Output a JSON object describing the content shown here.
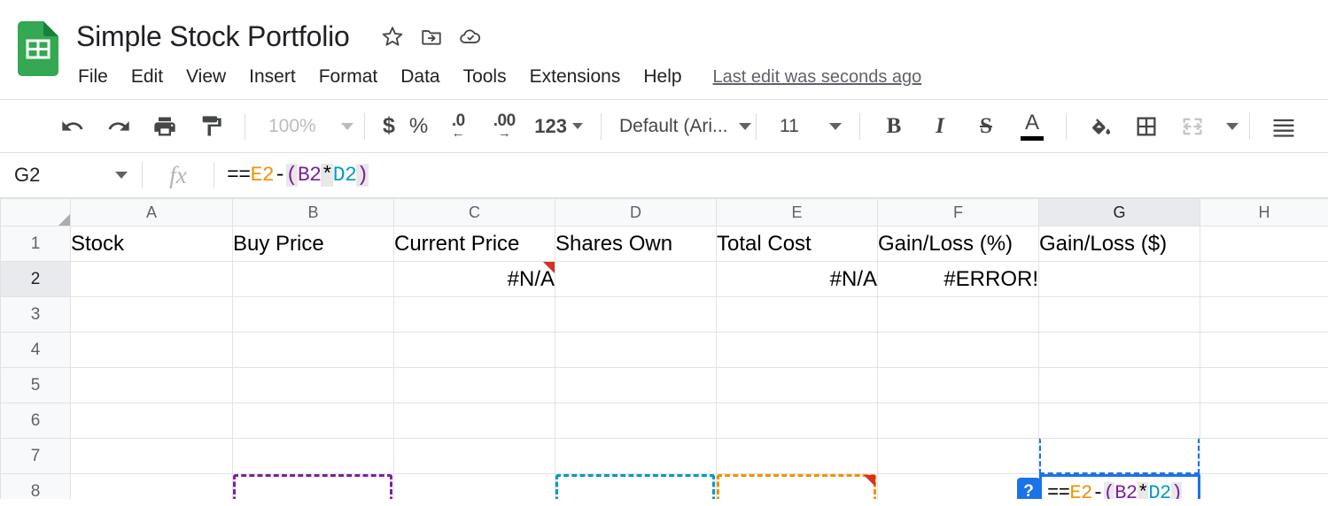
{
  "titlebar": {
    "doc_title": "Simple Stock Portfolio",
    "logo_icon": "google-sheets-logo",
    "icons": [
      {
        "name": "star-icon",
        "label": "Star"
      },
      {
        "name": "move-to-folder-icon",
        "label": "Move"
      },
      {
        "name": "cloud-saved-icon",
        "label": "Saved to Drive"
      }
    ],
    "menus": [
      "File",
      "Edit",
      "View",
      "Insert",
      "Format",
      "Data",
      "Tools",
      "Extensions",
      "Help"
    ],
    "last_edit": "Last edit was seconds ago"
  },
  "toolbar": {
    "undo": "undo-icon",
    "redo": "redo-icon",
    "print": "print-icon",
    "paint_format": "paint-format-icon",
    "zoom_value": "100%",
    "currency": "$",
    "percent": "%",
    "decrease_decimal_top": ".0",
    "decrease_decimal_arrow": "←",
    "increase_decimal_top": ".00",
    "increase_decimal_arrow": "→",
    "more_formats": "123",
    "font_family": "Default (Ari...",
    "font_size": "11",
    "bold": "B",
    "italic": "I",
    "strikethrough": "S",
    "text_color": "A",
    "text_color_swatch": "#000000",
    "fill_color": "fill-color-icon",
    "borders": "borders-icon",
    "merge_cells": "merge-cells-icon",
    "align": "align-icon"
  },
  "formula_bar": {
    "name_box": "G2",
    "fx_label": "fx",
    "formula_tokens": [
      {
        "text": "==",
        "cls": "t-plain"
      },
      {
        "text": "E2",
        "cls": "t-e2"
      },
      {
        "text": "-",
        "cls": "t-plain"
      },
      {
        "text": "(",
        "cls": "t-paren"
      },
      {
        "text": "B2",
        "cls": "t-b2"
      },
      {
        "text": "*",
        "cls": "t-paren-gap t-plain"
      },
      {
        "text": "D2",
        "cls": "t-d2"
      },
      {
        "text": ")",
        "cls": "t-paren"
      }
    ],
    "formula_raw": "==E2-(B2*D2)"
  },
  "grid": {
    "column_headers": [
      "A",
      "B",
      "C",
      "D",
      "E",
      "F",
      "G",
      "H"
    ],
    "active_column": "G",
    "active_row": "2",
    "row_headers": [
      "1",
      "2",
      "3",
      "4",
      "5",
      "6",
      "7",
      "8"
    ],
    "rows": [
      {
        "num": "1",
        "cells": [
          {
            "col": "A",
            "value": "Stock",
            "align": "left"
          },
          {
            "col": "B",
            "value": "Buy Price",
            "align": "left"
          },
          {
            "col": "C",
            "value": "Current Price",
            "align": "left"
          },
          {
            "col": "D",
            "value": "Shares Own",
            "align": "left"
          },
          {
            "col": "E",
            "value": "Total Cost",
            "align": "left"
          },
          {
            "col": "F",
            "value": "Gain/Loss (%)",
            "align": "left"
          },
          {
            "col": "G",
            "value": "Gain/Loss ($)",
            "align": "left"
          },
          {
            "col": "H",
            "value": "",
            "align": "left"
          }
        ]
      },
      {
        "num": "2",
        "cells": [
          {
            "col": "A",
            "value": "",
            "align": "left"
          },
          {
            "col": "B",
            "value": "",
            "align": "right"
          },
          {
            "col": "C",
            "value": "#N/A",
            "align": "right"
          },
          {
            "col": "D",
            "value": "",
            "align": "right"
          },
          {
            "col": "E",
            "value": "#N/A",
            "align": "right"
          },
          {
            "col": "F",
            "value": "#ERROR!",
            "align": "right"
          },
          {
            "col": "G",
            "value": "",
            "align": "right"
          },
          {
            "col": "H",
            "value": "",
            "align": "left"
          }
        ]
      },
      {
        "num": "3",
        "cells": []
      },
      {
        "num": "4",
        "cells": []
      },
      {
        "num": "5",
        "cells": []
      },
      {
        "num": "6",
        "cells": []
      },
      {
        "num": "7",
        "cells": []
      },
      {
        "num": "8",
        "cells": []
      }
    ],
    "reference_highlights": [
      {
        "cell": "B2",
        "color": "#7b1fa2",
        "style": "dashed"
      },
      {
        "cell": "D2",
        "color": "#009ac7",
        "style": "dashed"
      },
      {
        "cell": "E2",
        "color": "#f09300",
        "style": "dashed"
      }
    ],
    "error_indicators": [
      "C2",
      "E2"
    ],
    "error_indicator_color": "#d93025",
    "active_cell": {
      "ref": "G2",
      "border_color": "#1a73e8",
      "help_badge": "?"
    }
  }
}
